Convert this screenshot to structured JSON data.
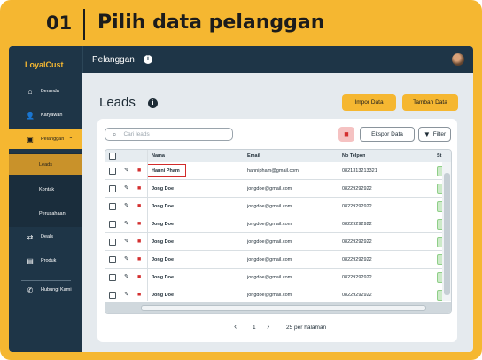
{
  "banner": {
    "step": "01",
    "title": "Pilih data pelanggan"
  },
  "app": {
    "logo": "LoyalCust",
    "topbar_title": "Pelanggan",
    "info_icon": "info-icon",
    "avatar": "user-avatar"
  },
  "sidebar": {
    "items": [
      {
        "label": "Beranda",
        "icon": "home-icon"
      },
      {
        "label": "Karyawan",
        "icon": "employee-icon"
      },
      {
        "label": "Pelanggan",
        "icon": "customer-icon",
        "active": true
      },
      {
        "label": "Deals",
        "icon": "deals-icon"
      },
      {
        "label": "Produk",
        "icon": "product-icon"
      },
      {
        "label": "Hubungi Kami",
        "icon": "whatsapp-icon"
      }
    ],
    "subitems": [
      {
        "label": "Leads",
        "active": true
      },
      {
        "label": "Kontak"
      },
      {
        "label": "Perusahaan"
      }
    ]
  },
  "main": {
    "title": "Leads",
    "import_label": "Impor Data",
    "add_label": "Tambah Data",
    "search_placeholder": "Cari leads",
    "export_label": "Ekspor Data",
    "filter_label": "Filter"
  },
  "table": {
    "headers": {
      "name": "Nama",
      "email": "Email",
      "phone": "No Telpon",
      "status": "St"
    },
    "rows": [
      {
        "name": "Hanni Pham",
        "email": "hannipham@gmail.com",
        "phone": "0821313213321",
        "highlighted": true
      },
      {
        "name": "Jong Doe",
        "email": "jongdoe@gmail.com",
        "phone": "08229292922"
      },
      {
        "name": "Jong Doe",
        "email": "jongdoe@gmail.com",
        "phone": "08229292922"
      },
      {
        "name": "Jong Doe",
        "email": "jongdoe@gmail.com",
        "phone": "08229292922"
      },
      {
        "name": "Jong Doe",
        "email": "jongdoe@gmail.com",
        "phone": "08229292922"
      },
      {
        "name": "Jong Doe",
        "email": "jongdoe@gmail.com",
        "phone": "08229292922"
      },
      {
        "name": "Jong Doe",
        "email": "jongdoe@gmail.com",
        "phone": "08229292922"
      },
      {
        "name": "Jong Doe",
        "email": "jongdoe@gmail.com",
        "phone": "08229292922"
      }
    ]
  },
  "pagination": {
    "page": "1",
    "page_size": "25 per halaman"
  },
  "colors": {
    "accent": "#f5b731",
    "sidebar": "#1e3547",
    "danger": "#d32f2f"
  }
}
